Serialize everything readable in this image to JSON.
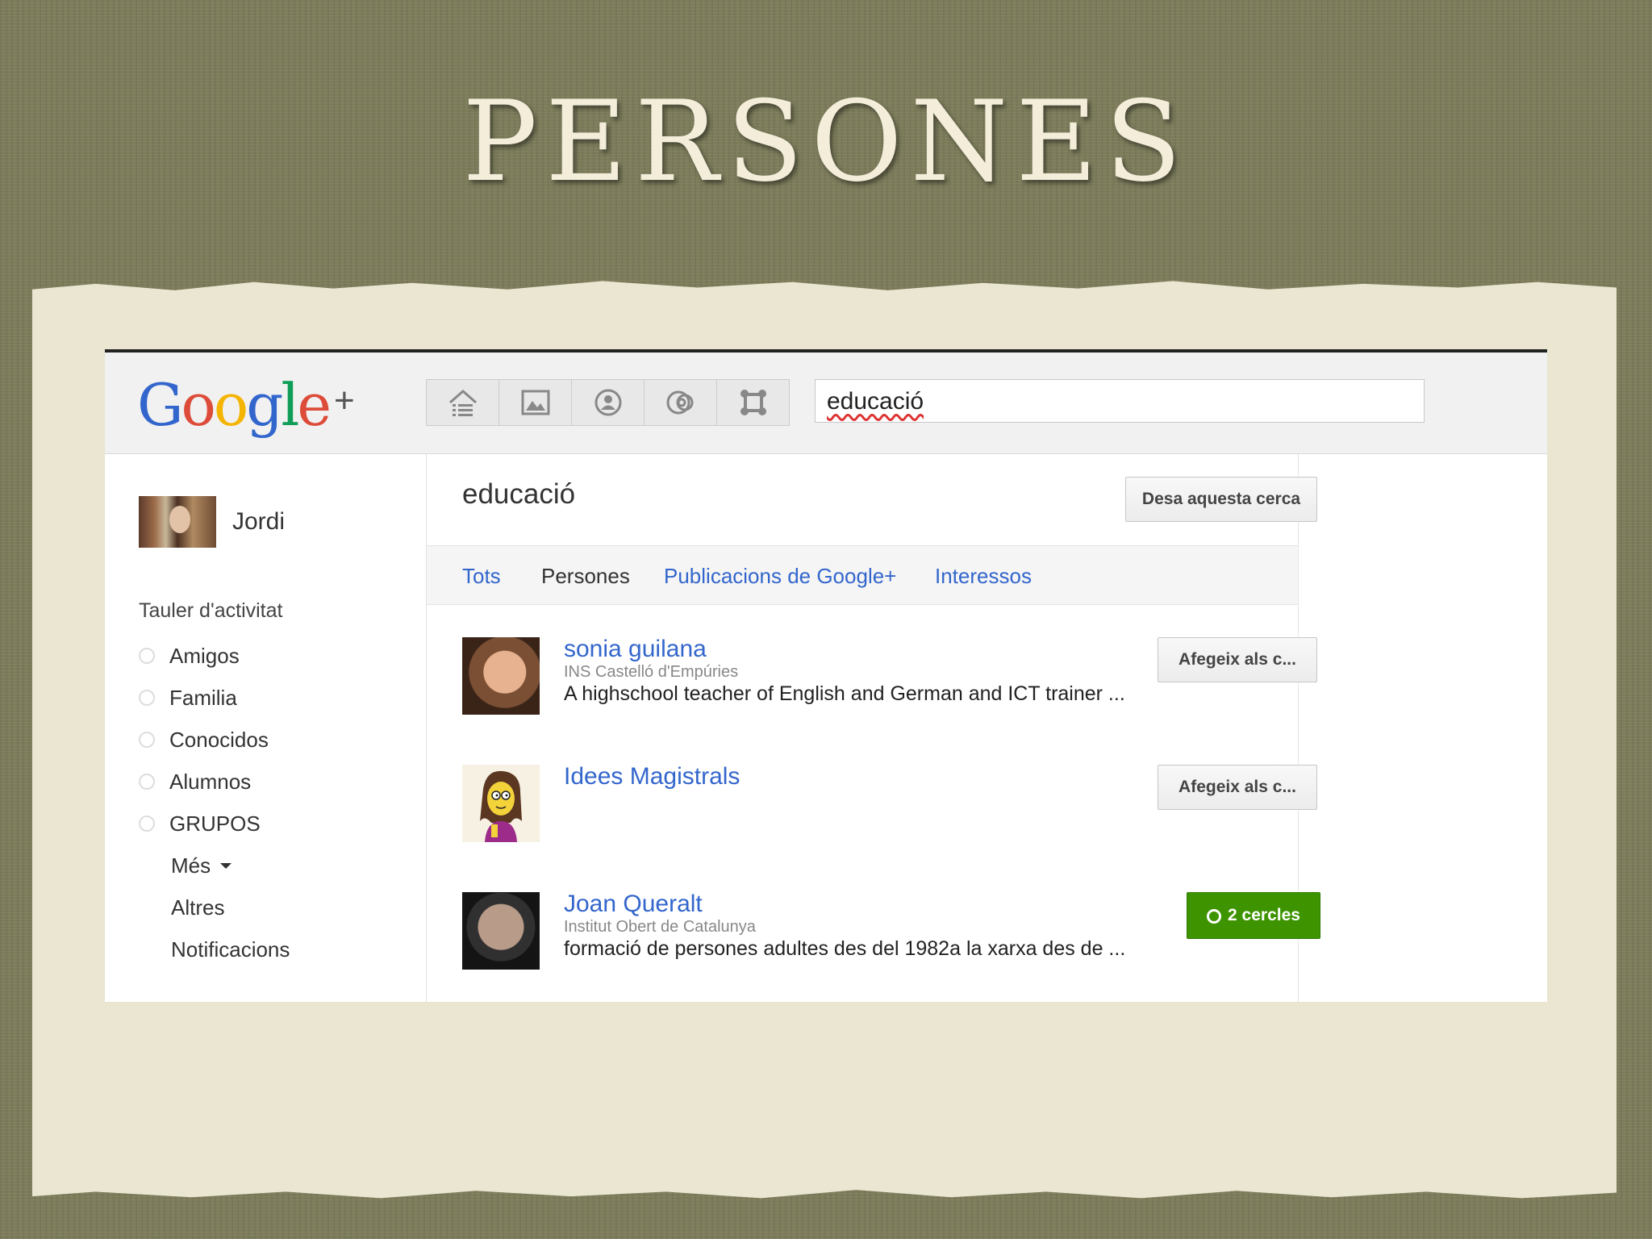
{
  "slide": {
    "title": "PERSONES"
  },
  "header": {
    "logo": {
      "g1": "G",
      "o1": "o",
      "o2": "o",
      "g2": "g",
      "l": "l",
      "e": "e",
      "plus": "+"
    },
    "nav_icons": [
      "home-icon",
      "photos-icon",
      "profile-icon",
      "circles-icon",
      "games-icon"
    ],
    "search": {
      "value": "educació"
    }
  },
  "sidebar": {
    "profile_name": "Jordi",
    "stream_heading": "Tauler d'activitat",
    "circles": [
      "Amigos",
      "Familia",
      "Conocidos",
      "Alumnos",
      "GRUPOS"
    ],
    "more": "Més",
    "others": "Altres",
    "notifications": "Notificacions"
  },
  "main": {
    "title": "educació",
    "save_search": "Desa aquesta cerca",
    "filters": [
      {
        "label": "Tots",
        "active": false
      },
      {
        "label": "Persones",
        "active": true
      },
      {
        "label": "Publicacions de Google+",
        "active": false
      },
      {
        "label": "Interessos",
        "active": false
      }
    ],
    "results": [
      {
        "name": "sonia guilana",
        "org": "INS Castelló d'Empúries",
        "description": "A highschool teacher of English and German and ICT trainer ...",
        "action": "Afegeix als c..."
      },
      {
        "name": "Idees Magistrals",
        "org": "",
        "description": "",
        "action": "Afegeix als c..."
      },
      {
        "name": "Joan Queralt",
        "org": "Institut Obert de Catalunya",
        "description": "formació de persones adultes des del 1982a la xarxa des de ...",
        "action": "2 cercles"
      }
    ]
  },
  "colors": {
    "link": "#3366cc",
    "in_circles_button": "#3d9400",
    "slide_background": "#7d7d5c",
    "paper": "#ebe6d2"
  }
}
